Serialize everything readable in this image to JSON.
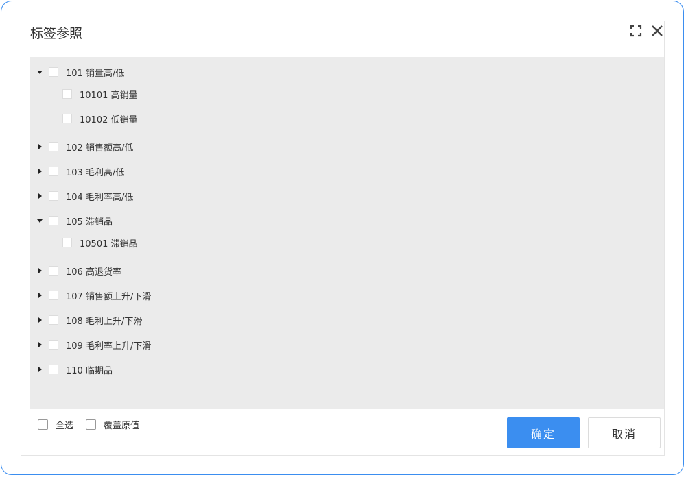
{
  "dialog": {
    "title": "标签参照",
    "maximize_icon": "maximize-icon",
    "close_icon": "close-icon"
  },
  "tree": [
    {
      "label": "101 销量高/低",
      "expanded": true
    },
    {
      "label": "10101 高销量",
      "child": true
    },
    {
      "label": "10102 低销量",
      "child": true
    },
    {
      "label": "102 销售额高/低",
      "expanded": false
    },
    {
      "label": "103 毛利高/低",
      "expanded": false
    },
    {
      "label": "104 毛利率高/低",
      "expanded": false
    },
    {
      "label": "105 滞销品",
      "expanded": true
    },
    {
      "label": "10501 滞销品",
      "child": true
    },
    {
      "label": "106 高退货率",
      "expanded": false
    },
    {
      "label": "107 销售额上升/下滑",
      "expanded": false
    },
    {
      "label": "108 毛利上升/下滑",
      "expanded": false
    },
    {
      "label": "109 毛利率上升/下滑",
      "expanded": false
    },
    {
      "label": "110 临期品",
      "expanded": false
    }
  ],
  "footer": {
    "select_all_label": "全选",
    "overwrite_label": "覆盖原值",
    "confirm_label": "确定",
    "cancel_label": "取消"
  },
  "colors": {
    "accent": "#3b8ef0",
    "panel_bg": "#ebebeb"
  }
}
